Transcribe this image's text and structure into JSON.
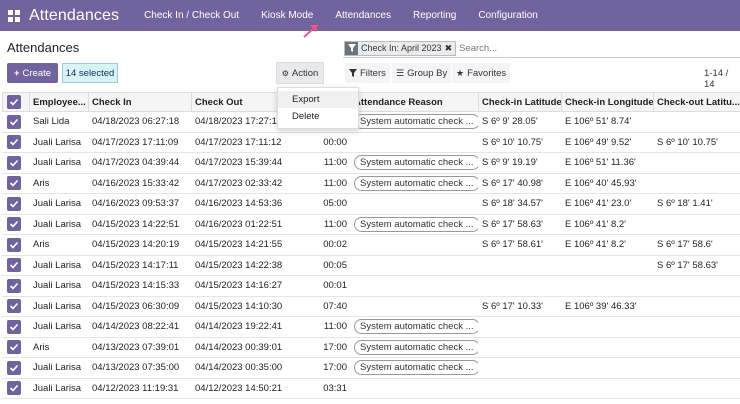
{
  "navbar": {
    "brand": "Attendances",
    "items": [
      "Check In / Check Out",
      "Kiosk Mode",
      "Attendances",
      "Reporting",
      "Configuration"
    ]
  },
  "page": {
    "title": "Attendances"
  },
  "search": {
    "facet": "Check In: April 2023",
    "placeholder": "Search..."
  },
  "toolbar": {
    "create": "Create",
    "selected": "14 selected",
    "action": "Action",
    "filters": "Filters",
    "group_by": "Group By",
    "favorites": "Favorites",
    "pager": "1-14 / 14"
  },
  "action_menu": [
    "Export",
    "Delete"
  ],
  "columns": [
    "Employee...",
    "Check In",
    "Check Out",
    "",
    "Attendance Reason",
    "Check-in Latitude",
    "Check-in Longitude",
    "Check-out Latitu..."
  ],
  "rows": [
    {
      "emp": "Sali Lida",
      "in": "04/18/2023 06:27:18",
      "out": "04/18/2023 17:27:18",
      "dur": "",
      "reason": "System automatic check ...",
      "lat": "S 6º 9' 28.05'",
      "lng": "E 106º 51' 8.74'",
      "olat": ""
    },
    {
      "emp": "Juali Larisa",
      "in": "04/17/2023 17:11:09",
      "out": "04/17/2023 17:11:12",
      "dur": "00:00",
      "reason": "",
      "lat": "S 6º 10' 10.75'",
      "lng": "E 106º 49' 9.52'",
      "olat": "S 6º 10' 10.75'"
    },
    {
      "emp": "Juali Larisa",
      "in": "04/17/2023 04:39:44",
      "out": "04/17/2023 15:39:44",
      "dur": "11:00",
      "reason": "System automatic check ...",
      "lat": "S 6º 9' 19.19'",
      "lng": "E 106º 51' 11.36'",
      "olat": ""
    },
    {
      "emp": "Aris",
      "in": "04/16/2023 15:33:42",
      "out": "04/17/2023 02:33:42",
      "dur": "11:00",
      "reason": "System automatic check ...",
      "lat": "S 6º 17' 40.98'",
      "lng": "E 106º 40' 45.93'",
      "olat": ""
    },
    {
      "emp": "Juali Larisa",
      "in": "04/16/2023 09:53:37",
      "out": "04/16/2023 14:53:36",
      "dur": "05:00",
      "reason": "",
      "lat": "S 6º 18' 34.57'",
      "lng": "E 106º 41' 23.0'",
      "olat": "S 6º 18' 1.41'"
    },
    {
      "emp": "Juali Larisa",
      "in": "04/15/2023 14:22:51",
      "out": "04/16/2023 01:22:51",
      "dur": "11:00",
      "reason": "System automatic check ...",
      "lat": "S 6º 17' 58.63'",
      "lng": "E 106º 41' 8.2'",
      "olat": ""
    },
    {
      "emp": "Aris",
      "in": "04/15/2023 14:20:19",
      "out": "04/15/2023 14:21:55",
      "dur": "00:02",
      "reason": "",
      "lat": "S 6º 17' 58.61'",
      "lng": "E 106º 41' 8.2'",
      "olat": "S 6º 17' 58.6'"
    },
    {
      "emp": "Juali Larisa",
      "in": "04/15/2023 14:17:11",
      "out": "04/15/2023 14:22:38",
      "dur": "00:05",
      "reason": "",
      "lat": "",
      "lng": "",
      "olat": "S 6º 17' 58.63'"
    },
    {
      "emp": "Juali Larisa",
      "in": "04/15/2023 14:15:33",
      "out": "04/15/2023 14:16:27",
      "dur": "00:01",
      "reason": "",
      "lat": "",
      "lng": "",
      "olat": ""
    },
    {
      "emp": "Juali Larisa",
      "in": "04/15/2023 06:30:09",
      "out": "04/15/2023 14:10:30",
      "dur": "07:40",
      "reason": "",
      "lat": "S 6º 17' 10.33'",
      "lng": "E 106º 39' 46.33'",
      "olat": ""
    },
    {
      "emp": "Juali Larisa",
      "in": "04/14/2023 08:22:41",
      "out": "04/14/2023 19:22:41",
      "dur": "11:00",
      "reason": "System automatic check ...",
      "lat": "",
      "lng": "",
      "olat": ""
    },
    {
      "emp": "Aris",
      "in": "04/13/2023 07:39:01",
      "out": "04/14/2023 00:39:01",
      "dur": "17:00",
      "reason": "System automatic check ...",
      "lat": "",
      "lng": "",
      "olat": ""
    },
    {
      "emp": "Juali Larisa",
      "in": "04/13/2023 07:35:00",
      "out": "04/14/2023 00:35:00",
      "dur": "17:00",
      "reason": "System automatic check ...",
      "lat": "",
      "lng": "",
      "olat": ""
    },
    {
      "emp": "Juali Larisa",
      "in": "04/12/2023 11:19:31",
      "out": "04/12/2023 14:50:21",
      "dur": "03:31",
      "reason": "",
      "lat": "",
      "lng": "",
      "olat": ""
    }
  ],
  "colors": {
    "brand": "#71639e",
    "selected_bg": "#d9f2f2",
    "cursor": "#e8578a"
  }
}
